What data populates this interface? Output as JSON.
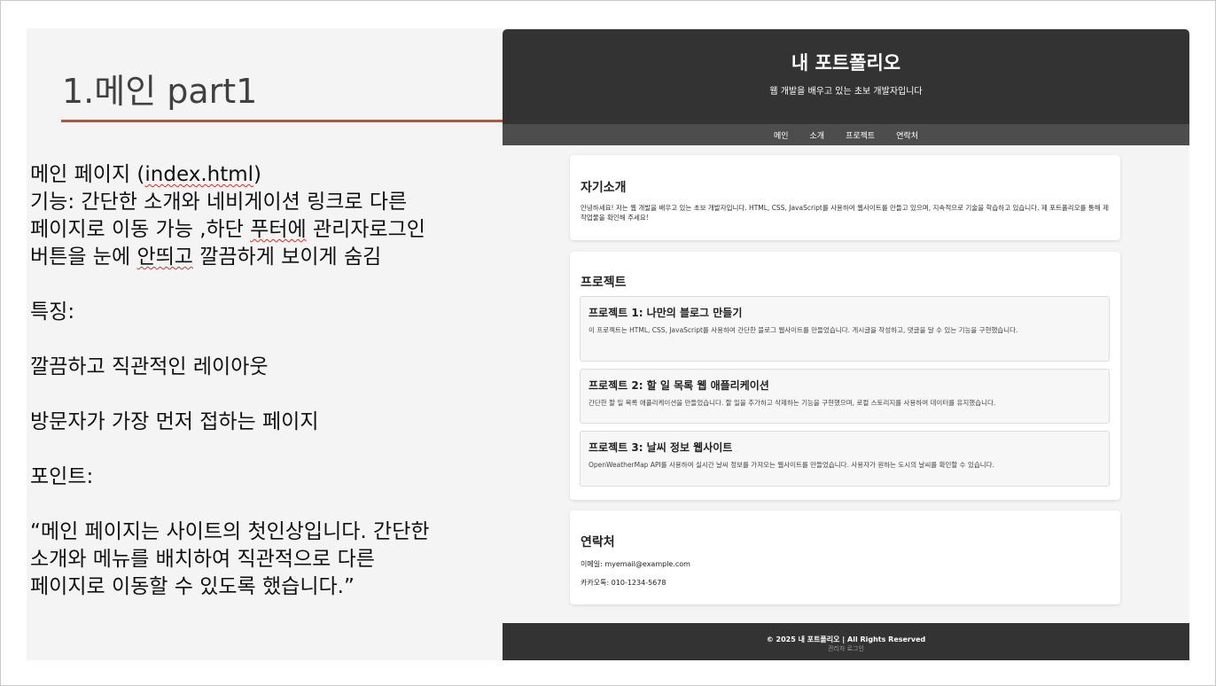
{
  "slide": {
    "title": "1.메인 part1",
    "lines": {
      "l1_a": "메인 페이지 (",
      "l1_b": "index.html",
      "l1_c": ")",
      "l2": "기능: 간단한 소개와 네비게이션 링크로 다른",
      "l3_a": "페이지로 이동 가능 ,하단 ",
      "l3_b": "푸터에",
      "l3_c": " 관리자로그인",
      "l4_a": "버튼을 눈에 ",
      "l4_b": "안띄고",
      "l4_c": " 깔끔하게 보이게 숨김",
      "features_label": "특징:",
      "feature1": "깔끔하고 직관적인 레이아웃",
      "feature2": "방문자가 가장 먼저 접하는 페이지",
      "point_label": "포인트:",
      "quote1": "“메인 페이지는 사이트의 첫인상입니다. 간단한",
      "quote2": "소개와 메뉴를 배치하여 직관적으로 다른",
      "quote3": "페이지로 이동할 수 있도록 했습니다.”"
    }
  },
  "site": {
    "title": "내 포트폴리오",
    "subtitle": "웹 개발을 배우고 있는 초보 개발자입니다",
    "nav": [
      "메인",
      "소개",
      "프로젝트",
      "연락처"
    ],
    "intro": {
      "heading": "자기소개",
      "text": "안녕하세요! 저는 웹 개발을 배우고 있는 초보 개발자입니다. HTML, CSS, JavaScript를 사용하여 웹사이트를 만들고 있으며, 지속적으로 기술을 학습하고 있습니다. 제 포트폴리오를 통해 제 작업물을 확인해 주세요!"
    },
    "projects": {
      "heading": "프로젝트",
      "items": [
        {
          "title": "프로젝트 1: 나만의 블로그 만들기",
          "desc": "이 프로젝트는 HTML, CSS, JavaScript를 사용하여 간단한 블로그 웹사이트를 만들었습니다. 게시글을 작성하고, 댓글을 달 수 있는 기능을 구현했습니다."
        },
        {
          "title": "프로젝트 2: 할 일 목록 웹 애플리케이션",
          "desc": "간단한 할 일 목록 애플리케이션을 만들었습니다. 할 일을 추가하고 삭제하는 기능을 구현했으며, 로컬 스토리지를 사용하여 데이터를 유지했습니다."
        },
        {
          "title": "프로젝트 3: 날씨 정보 웹사이트",
          "desc": "OpenWeatherMap API를 사용하여 실시간 날씨 정보를 가져오는 웹사이트를 만들었습니다. 사용자가 원하는 도시의 날씨를 확인할 수 있습니다."
        }
      ]
    },
    "contact": {
      "heading": "연락처",
      "email": "이메일: myemail@example.com",
      "kakao": "카카오톡: 010-1234-5678"
    },
    "footer": {
      "copyright": "© 2025 내 포트폴리오 | All Rights Reserved",
      "admin_link": "관리자 로그인"
    }
  },
  "colors": {
    "accent_rule": "#c0502f",
    "header_bg": "#333333",
    "nav_bg": "#4d4d4d",
    "slide_bg": "#f4f4f4",
    "spellcheck_underline": "#d9302b"
  }
}
